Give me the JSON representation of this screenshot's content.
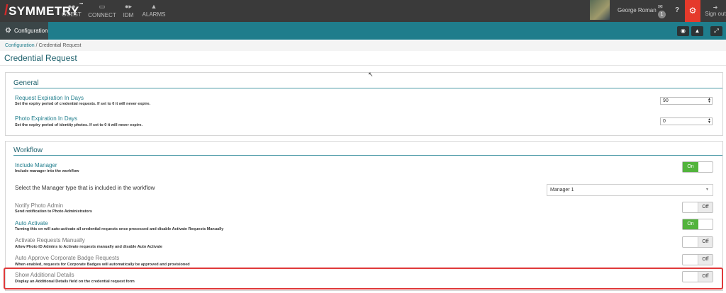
{
  "app": {
    "logo_text": "SYMMETRY",
    "tm": "™"
  },
  "topnav": {
    "items": [
      {
        "label": "GUEST",
        "icon": "users-icon"
      },
      {
        "label": "CONNECT",
        "icon": "card-icon"
      },
      {
        "label": "IDM",
        "icon": "id-user-icon"
      },
      {
        "label": "ALARMS",
        "icon": "bell-icon"
      }
    ],
    "username": "George Roman",
    "mail_count": "1",
    "help": "?",
    "signout": "Sign out"
  },
  "subnav": {
    "configuration_tab": "Configuration"
  },
  "breadcrumb": {
    "root": "Configuration",
    "sep": "/",
    "current": "Credential Request"
  },
  "page": {
    "title": "Credential Request"
  },
  "general": {
    "title": "General",
    "request_expiration": {
      "label": "Request Expiration In Days",
      "desc": "Set the expiry period of credential requests. If set to 0 it will never expire.",
      "value": "90"
    },
    "photo_expiration": {
      "label": "Photo Expiration In Days",
      "desc": "Set the expiry period of identity photos. If set to 0 it will never expire.",
      "value": "0"
    }
  },
  "workflow": {
    "title": "Workflow",
    "include_manager": {
      "label": "Include Manager",
      "desc": "Include manager into the workflow",
      "state": "On"
    },
    "manager_type": {
      "label": "Select the Manager type that is included in the workflow",
      "value": "Manager 1"
    },
    "notify_photo_admin": {
      "label": "Notify Photo Admin",
      "desc": "Send notification to Photo Administrators",
      "state": "Off"
    },
    "auto_activate": {
      "label": "Auto Activate",
      "desc": "Turning this on will auto-activate all credential requests once processed and disable Activate Requests Manually",
      "state": "On"
    },
    "activate_manually": {
      "label": "Activate Requests Manually",
      "desc": "Allow Photo ID Admins to Activate requests manually and disable Auto Activate",
      "state": "Off"
    },
    "auto_approve": {
      "label": "Auto Approve Corporate Badge Requests",
      "desc": "When enabled, requests for Corporate Badges will automatically be approved and provisioned",
      "state": "Off"
    },
    "show_additional": {
      "label": "Show Additional Details",
      "desc": "Display an Additional Details field on the credential request form",
      "state": "Off"
    }
  },
  "colors": {
    "topbar": "#3a3a3a",
    "teal": "#1f7d8c",
    "accent_red": "#e53a2b",
    "toggle_on": "#52b33c",
    "highlight": "#e0393a"
  }
}
